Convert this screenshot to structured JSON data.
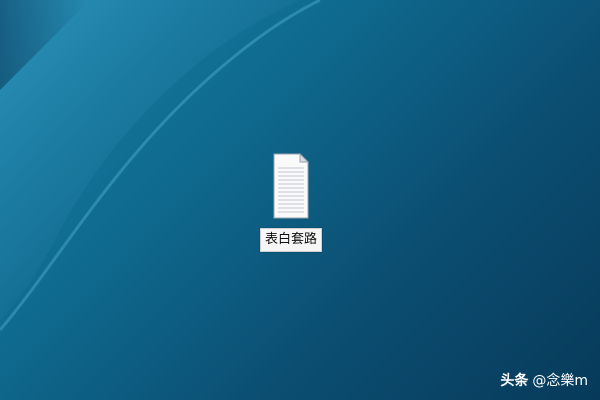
{
  "desktop": {
    "icons": [
      {
        "label": "表白套路",
        "icon": "text-file-icon"
      }
    ]
  },
  "watermark": {
    "brand": "头条",
    "handle": "@念樂m"
  },
  "colors": {
    "wallpaper_light": "#1a7fa5",
    "wallpaper_dark": "#073a5a",
    "label_bg": "#f6f6f6"
  }
}
